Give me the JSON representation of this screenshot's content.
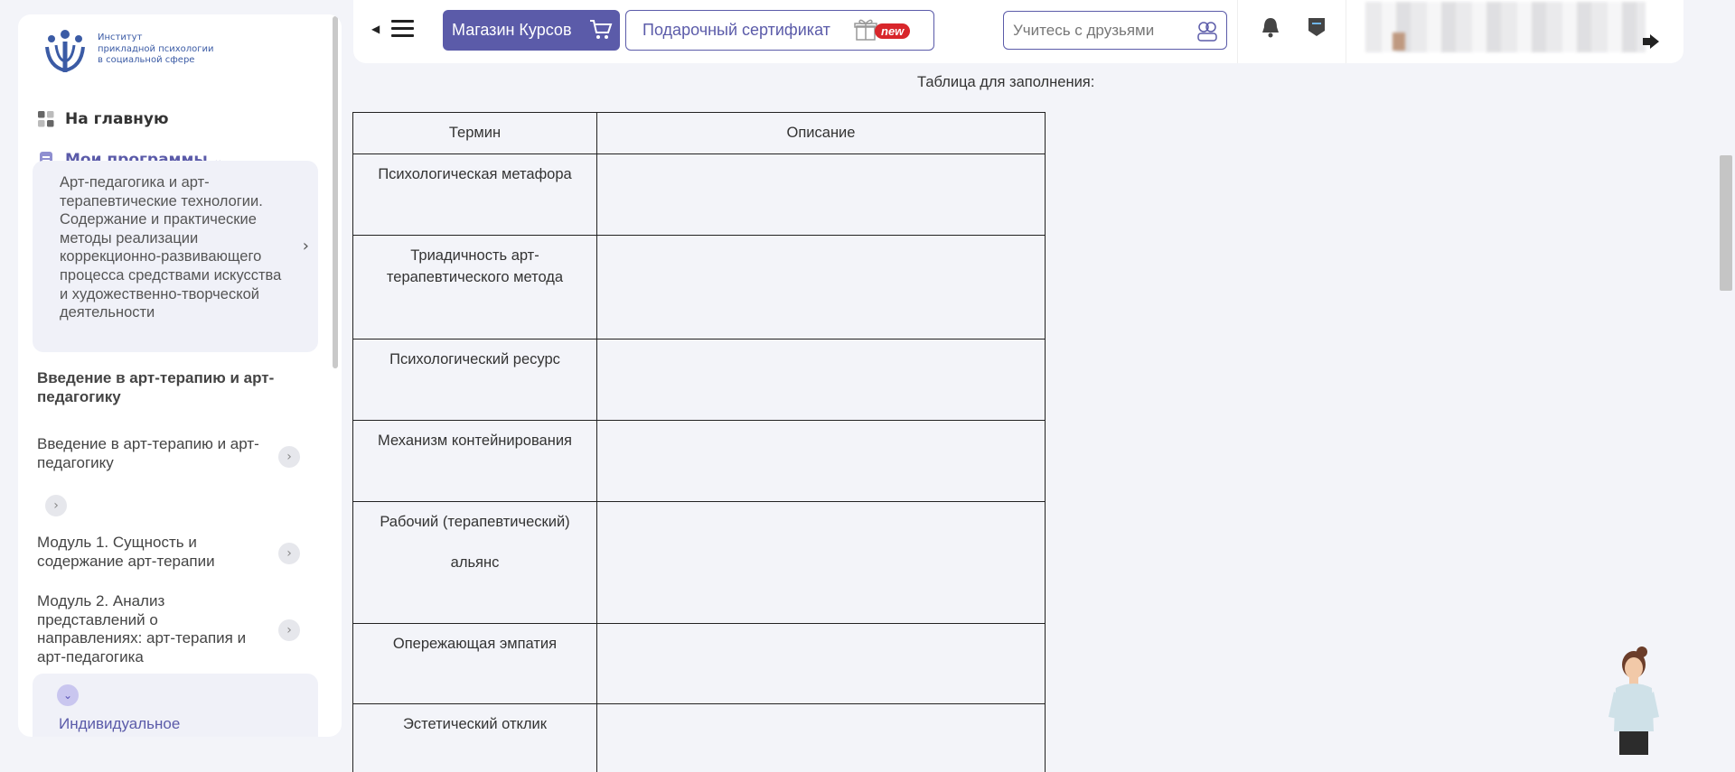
{
  "logo": {
    "text": "Институт прикладной психологии в социальной сфере",
    "lines": [
      "Институт",
      "прикладной психологии",
      "в социальной сфере"
    ]
  },
  "sidebar": {
    "home_label": "На главную",
    "programs_label": "Мои программы",
    "program_title": "Арт-педагогика и арт-терапевтические технологии. Содержание и практические методы реализации коррекционно-развивающего процесса средствами искусства и художественно-творческой деятельности",
    "section_title": "Введение в арт-терапию и арт-педагогику",
    "lessons": [
      {
        "label": "Введение в арт-терапию и арт-педагогику"
      },
      {
        "label": ""
      },
      {
        "label": "Модуль 1. Сущность и содержание арт-терапии"
      },
      {
        "label": "Модуль 2. Анализ представлений о направлениях: арт-терапия и арт-педагогика"
      }
    ],
    "active_task": "Индивидуальное практическое задание"
  },
  "topbar": {
    "shop_label": "Магазин Курсов",
    "gift_label": "Подарочный сертификат",
    "new_badge": "new",
    "friends_label": "Учитесь с друзьями"
  },
  "content": {
    "caption": "Таблица для заполнения:",
    "headers": [
      "Термин",
      "Описание"
    ],
    "rows": [
      {
        "term": "Психологическая метафора",
        "description": ""
      },
      {
        "term": "Триадичность арт-терапевтического метода",
        "description": ""
      },
      {
        "term": "Психологический ресурс",
        "description": ""
      },
      {
        "term": "Механизм контейнирования",
        "description": ""
      },
      {
        "term": "Рабочий (терапевтический) альянс",
        "description": ""
      },
      {
        "term": "Опережающая эмпатия",
        "description": ""
      },
      {
        "term": "Эстетический отклик",
        "description": ""
      }
    ]
  },
  "colors": {
    "accent": "#5b5ba9",
    "badge": "#d8262b",
    "logo": "#3b5ba5"
  }
}
